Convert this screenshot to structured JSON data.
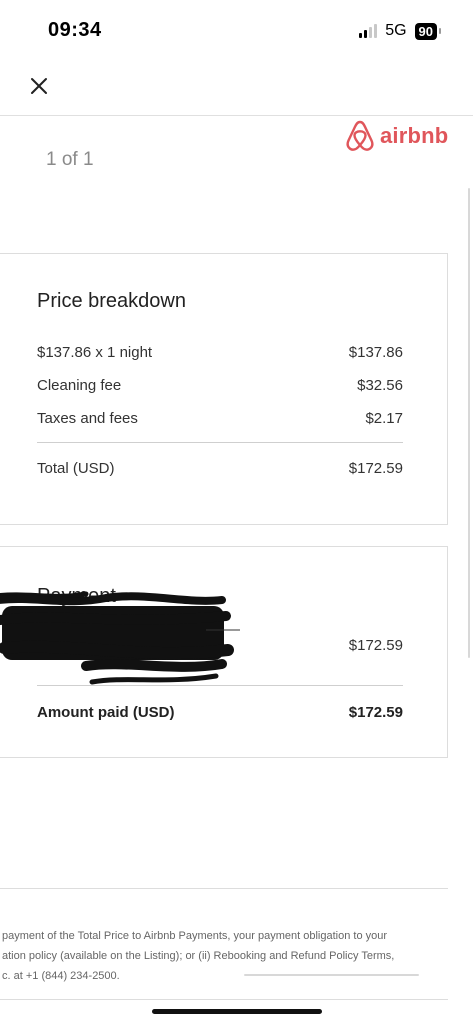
{
  "status_bar": {
    "time": "09:34",
    "network": "5G",
    "battery": "90"
  },
  "header": {
    "close_icon": "close-icon",
    "page_indicator": "1 of 1",
    "logo_text": "airbnb",
    "brand_color": "#e0565b"
  },
  "price_breakdown": {
    "title": "Price breakdown",
    "items": [
      {
        "label": "$137.86 x 1 night",
        "value": "$137.86"
      },
      {
        "label": "Cleaning fee",
        "value": "$32.56"
      },
      {
        "label": "Taxes and fees",
        "value": "$2.17"
      }
    ],
    "total_label": "Total (USD)",
    "total_value": "$172.59"
  },
  "payment": {
    "title": "Payment",
    "amount": "$172.59",
    "amount_paid_label": "Amount paid (USD)",
    "amount_paid_value": "$172.59"
  },
  "footer": {
    "lines": [
      "payment of the Total Price to Airbnb Payments, your payment obligation to your",
      "ation policy (available on the Listing); or (ii) Rebooking and Refund Policy Terms,",
      "c. at +1 (844) 234-2500."
    ]
  }
}
